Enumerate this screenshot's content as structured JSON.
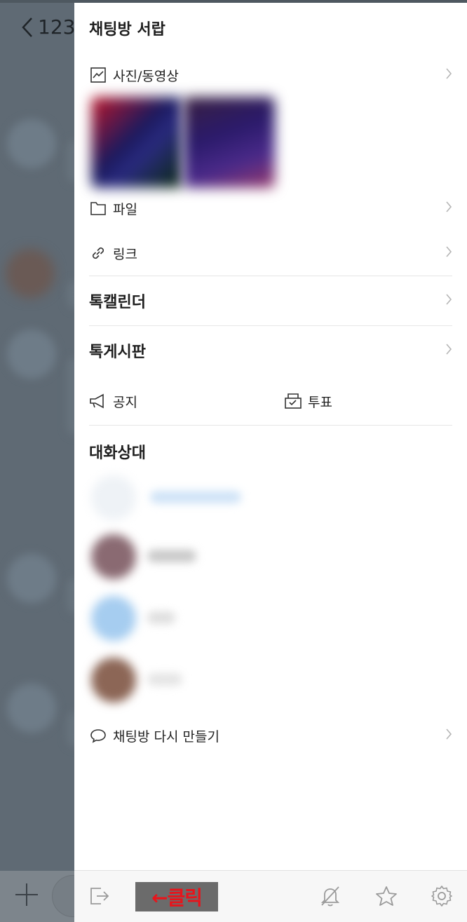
{
  "background": {
    "back_label": "123"
  },
  "drawer": {
    "title": "채팅방 서랍",
    "media": {
      "label": "사진/동영상",
      "icon": "image-icon"
    },
    "file": {
      "label": "파일",
      "icon": "folder-icon"
    },
    "link": {
      "label": "링크",
      "icon": "link-icon"
    },
    "calendar": {
      "label": "톡캘린더"
    },
    "board": {
      "label": "톡게시판"
    },
    "notice": {
      "label": "공지",
      "icon": "megaphone-icon"
    },
    "vote": {
      "label": "투표",
      "icon": "ballot-box-icon"
    },
    "members_title": "대화상대",
    "recreate": {
      "label": "채팅방 다시 만들기",
      "icon": "speech-bubble-icon"
    }
  },
  "bottom_bar": {
    "icons": [
      "exit-icon",
      "bell-off-icon",
      "star-icon",
      "gear-icon"
    ],
    "annotation": "←클릭"
  },
  "colors": {
    "annotation_bg": "#6b6b6b",
    "annotation_text": "#e8141b",
    "dim_overlay": "#5f6a74"
  }
}
